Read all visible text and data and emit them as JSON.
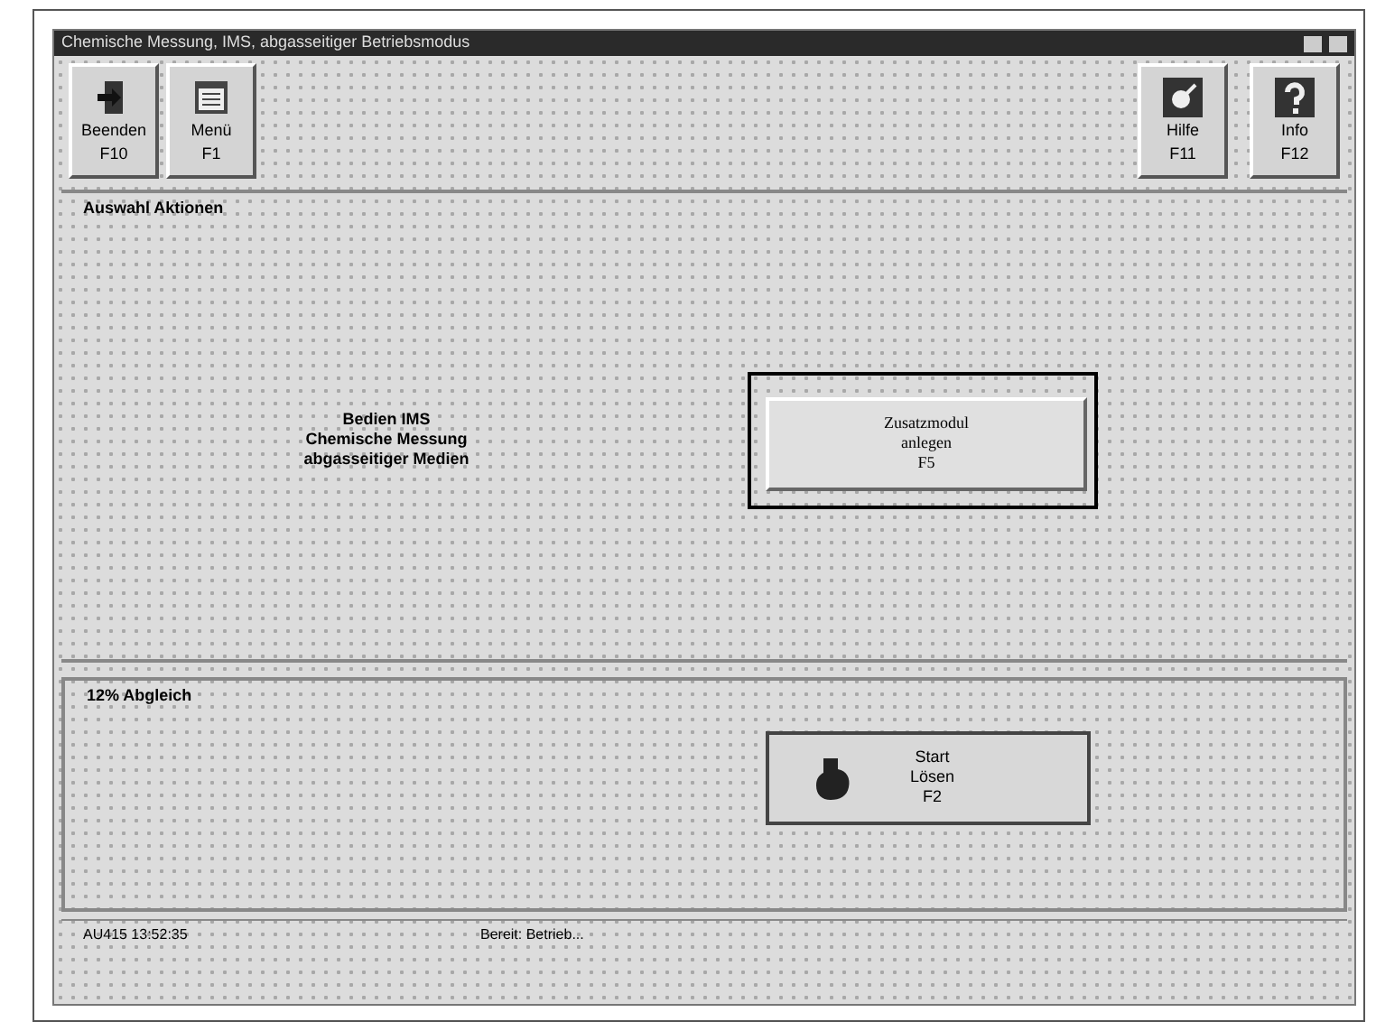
{
  "window": {
    "title": "Chemische Messung, IMS, abgasseitiger Betriebsmodus"
  },
  "toolbar_left": [
    {
      "kind": "exit",
      "label": "Beenden",
      "key": "F10"
    },
    {
      "kind": "menu",
      "label": "Menü",
      "key": "F1"
    }
  ],
  "toolbar_right": [
    {
      "kind": "tool",
      "label": "Hilfe",
      "key": "F11"
    },
    {
      "kind": "help",
      "label": "Info",
      "key": "F12"
    }
  ],
  "actions": {
    "title": "Auswahl Aktionen",
    "description": [
      "Bedien IMS",
      "Chemische Messung",
      "abgasseitiger Medien"
    ],
    "button": {
      "lines": [
        "Zusatzmodul",
        "anlegen",
        "F5"
      ],
      "highlighted": true
    }
  },
  "calibration": {
    "title": "12% Abgleich",
    "button": {
      "lines": [
        "Start",
        "Lösen",
        "F2"
      ]
    }
  },
  "status_bar": [
    "AU415 13:52:35",
    "Bereit: Betrieb..."
  ]
}
